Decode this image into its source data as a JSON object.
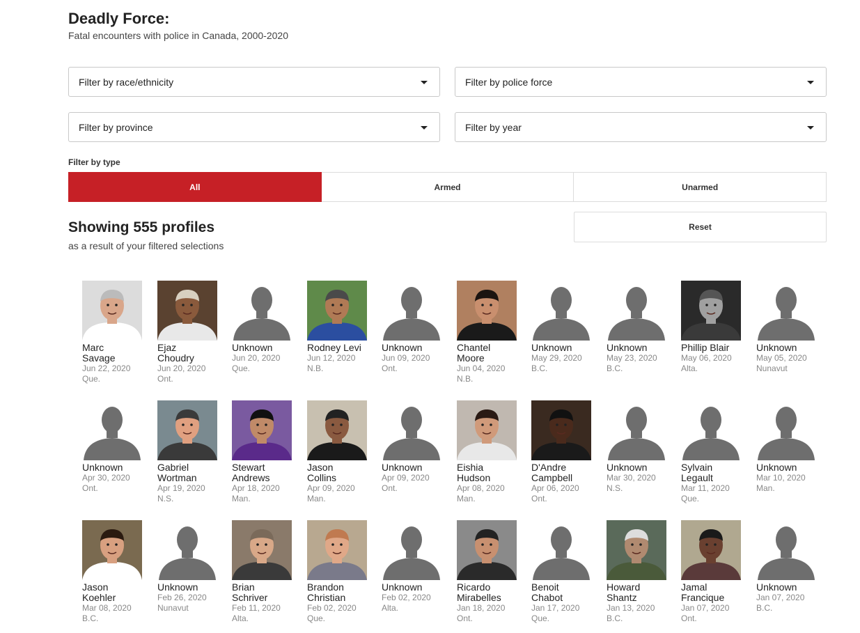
{
  "header": {
    "title": "Deadly Force:",
    "subtitle": "Fatal encounters with police in Canada, 2000-2020"
  },
  "filters": {
    "race": "Filter by race/ethnicity",
    "police": "Filter by police force",
    "province": "Filter by province",
    "year": "Filter by year"
  },
  "type_filter": {
    "label": "Filter by type",
    "options": [
      "All",
      "Armed",
      "Unarmed"
    ],
    "selected": "All"
  },
  "results": {
    "title": "Showing 555 profiles",
    "subtitle": "as a result of your filtered selections",
    "reset_label": "Reset"
  },
  "colors": {
    "accent": "#c62026",
    "placeholder_bg": "#ffffff",
    "placeholder_silhouette": "#6e6e6e"
  },
  "profiles": [
    {
      "first": "Marc",
      "last": "Savage",
      "date": "Jun 22, 2020",
      "prov": "Que.",
      "photo": "photo",
      "skin": "#d9a68a",
      "bg": "#dcdcdc",
      "shirt": "#ffffff",
      "hair": "#bbbbbb"
    },
    {
      "first": "Ejaz",
      "last": "Choudry",
      "date": "Jun 20, 2020",
      "prov": "Ont.",
      "photo": "photo",
      "skin": "#8a5a3c",
      "bg": "#5a4230",
      "shirt": "#e8e8e8",
      "hair": "#d8d0c0"
    },
    {
      "first": "Unknown",
      "last": "",
      "date": "Jun 20, 2020",
      "prov": "Que.",
      "photo": "placeholder"
    },
    {
      "first": "Rodney Levi",
      "last": "",
      "date": "Jun 12, 2020",
      "prov": "N.B.",
      "photo": "photo",
      "skin": "#b07a55",
      "bg": "#5f8a4a",
      "shirt": "#2b4ea0",
      "hair": "#4a4a4a"
    },
    {
      "first": "Unknown",
      "last": "",
      "date": "Jun 09, 2020",
      "prov": "Ont.",
      "photo": "placeholder"
    },
    {
      "first": "Chantel",
      "last": "Moore",
      "date": "Jun 04, 2020",
      "prov": "N.B.",
      "photo": "photo",
      "skin": "#c98f6e",
      "bg": "#b08060",
      "shirt": "#1a1a1a",
      "hair": "#1c1410"
    },
    {
      "first": "Unknown",
      "last": "",
      "date": "May 29, 2020",
      "prov": "B.C.",
      "photo": "placeholder"
    },
    {
      "first": "Unknown",
      "last": "",
      "date": "May 23, 2020",
      "prov": "B.C.",
      "photo": "placeholder"
    },
    {
      "first": "Phillip Blair",
      "last": "",
      "date": "May 06, 2020",
      "prov": "Alta.",
      "photo": "photo",
      "skin": "#a0a0a0",
      "bg": "#2a2a2a",
      "shirt": "#3a3a3a",
      "hair": "#555555"
    },
    {
      "first": "Unknown",
      "last": "",
      "date": "May 05, 2020",
      "prov": "Nunavut",
      "photo": "placeholder"
    },
    {
      "first": "Unknown",
      "last": "",
      "date": "Apr 30, 2020",
      "prov": "Ont.",
      "photo": "placeholder"
    },
    {
      "first": "Gabriel",
      "last": "Wortman",
      "date": "Apr 19, 2020",
      "prov": "N.S.",
      "photo": "photo",
      "skin": "#e0a080",
      "bg": "#7a8a90",
      "shirt": "#3a3a3a",
      "hair": "#3a3a3a"
    },
    {
      "first": "Stewart",
      "last": "Andrews",
      "date": "Apr 18, 2020",
      "prov": "Man.",
      "photo": "photo",
      "skin": "#c08a68",
      "bg": "#7a5aa0",
      "shirt": "#5a2a8a",
      "hair": "#111111"
    },
    {
      "first": "Jason",
      "last": "Collins",
      "date": "Apr 09, 2020",
      "prov": "Man.",
      "photo": "photo",
      "skin": "#8a5a40",
      "bg": "#c8c0b0",
      "shirt": "#1a1a1a",
      "hair": "#222222"
    },
    {
      "first": "Unknown",
      "last": "",
      "date": "Apr 09, 2020",
      "prov": "Ont.",
      "photo": "placeholder"
    },
    {
      "first": "Eishia",
      "last": "Hudson",
      "date": "Apr 08, 2020",
      "prov": "Man.",
      "photo": "photo",
      "skin": "#d09a7a",
      "bg": "#c0b8b0",
      "shirt": "#e8e8e8",
      "hair": "#2a1a14"
    },
    {
      "first": "D'Andre",
      "last": "Campbell",
      "date": "Apr 06, 2020",
      "prov": "Ont.",
      "photo": "photo",
      "skin": "#4a2a1c",
      "bg": "#3a2a20",
      "shirt": "#1a1a1a",
      "hair": "#111111"
    },
    {
      "first": "Unknown",
      "last": "",
      "date": "Mar 30, 2020",
      "prov": "N.S.",
      "photo": "placeholder"
    },
    {
      "first": "Sylvain",
      "last": "Legault",
      "date": "Mar 11, 2020",
      "prov": "Que.",
      "photo": "placeholder"
    },
    {
      "first": "Unknown",
      "last": "",
      "date": "Mar 10, 2020",
      "prov": "Man.",
      "photo": "placeholder"
    },
    {
      "first": "Jason",
      "last": "Koehler",
      "date": "Mar 08, 2020",
      "prov": "B.C.",
      "photo": "photo",
      "skin": "#d8a080",
      "bg": "#7a6a50",
      "shirt": "#ffffff",
      "hair": "#2a1a10"
    },
    {
      "first": "Unknown",
      "last": "",
      "date": "Feb 26, 2020",
      "prov": "Nunavut",
      "photo": "placeholder"
    },
    {
      "first": "Brian",
      "last": "Schriver",
      "date": "Feb 11, 2020",
      "prov": "Alta.",
      "photo": "photo",
      "skin": "#d8a888",
      "bg": "#8a7a6a",
      "shirt": "#3a3a3a",
      "hair": "#7a6a5a"
    },
    {
      "first": "Brandon",
      "last": "Christian",
      "date": "Feb 02, 2020",
      "prov": "Que.",
      "photo": "photo",
      "skin": "#e0a888",
      "bg": "#b8a890",
      "shirt": "#7a7a8a",
      "hair": "#c07a50"
    },
    {
      "first": "Unknown",
      "last": "",
      "date": "Feb 02, 2020",
      "prov": "Alta.",
      "photo": "placeholder"
    },
    {
      "first": "Ricardo",
      "last": "Mirabelles",
      "date": "Jan 18, 2020",
      "prov": "Ont.",
      "photo": "photo",
      "skin": "#c89070",
      "bg": "#8a8a8a",
      "shirt": "#2a2a2a",
      "hair": "#222222"
    },
    {
      "first": "Benoit",
      "last": "Chabot",
      "date": "Jan 17, 2020",
      "prov": "Que.",
      "photo": "placeholder"
    },
    {
      "first": "Howard",
      "last": "Shantz",
      "date": "Jan 13, 2020",
      "prov": "B.C.",
      "photo": "photo",
      "skin": "#b08a70",
      "bg": "#5a6a5a",
      "shirt": "#4a5a3a",
      "hair": "#dddddd"
    },
    {
      "first": "Jamal",
      "last": "Francique",
      "date": "Jan 07, 2020",
      "prov": "Ont.",
      "photo": "photo",
      "skin": "#6a4030",
      "bg": "#b0a890",
      "shirt": "#5a3a3a",
      "hair": "#1a1a1a"
    },
    {
      "first": "Unknown",
      "last": "",
      "date": "Jan 07, 2020",
      "prov": "B.C.",
      "photo": "placeholder"
    }
  ]
}
